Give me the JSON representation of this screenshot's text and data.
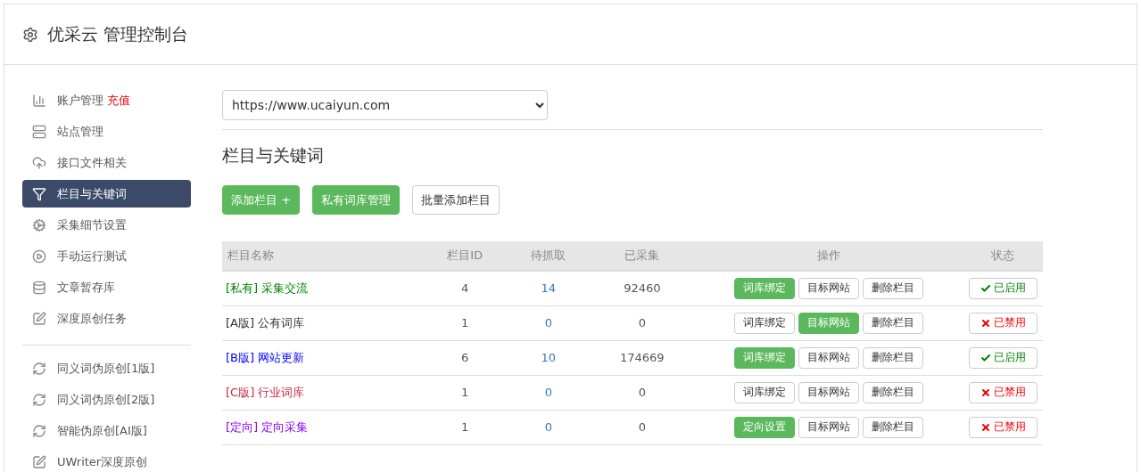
{
  "header": {
    "title": "优采云 管理控制台"
  },
  "sidebar": {
    "items": [
      {
        "label": "账户管理",
        "badge": "充值",
        "selected": false
      },
      {
        "label": "站点管理",
        "selected": false
      },
      {
        "label": "接口文件相关",
        "selected": false
      },
      {
        "label": "栏目与关键词",
        "selected": true
      },
      {
        "label": "采集细节设置",
        "selected": false
      },
      {
        "label": "手动运行测试",
        "selected": false
      },
      {
        "label": "文章暂存库",
        "selected": false
      },
      {
        "label": "深度原创任务",
        "selected": false
      }
    ],
    "items_2": [
      {
        "label": "同义词伪原创[1版]",
        "selected": false
      },
      {
        "label": "同义词伪原创[2版]",
        "selected": false
      },
      {
        "label": "智能伪原创[AI版]",
        "selected": false
      },
      {
        "label": "UWriter深度原创",
        "selected": false
      }
    ]
  },
  "site_select": {
    "value": "https://www.ucaiyun.com"
  },
  "section_title": "栏目与关键词",
  "toolbar": [
    {
      "label": "添加栏目 +",
      "primary": true
    },
    {
      "label": "私有词库管理",
      "primary": true
    },
    {
      "label": "批量添加栏目",
      "primary": false
    }
  ],
  "table": {
    "columns": [
      "栏目名称",
      "栏目ID",
      "待抓取",
      "已采集",
      "操作",
      "状态"
    ],
    "rows": [
      {
        "name": "[私有] 采集交流",
        "color": "#008000",
        "id": "4",
        "pending": "14",
        "collected": "92460",
        "actions": [
          {
            "label": "词库绑定",
            "primary": true
          },
          {
            "label": "目标网站",
            "primary": false
          },
          {
            "label": "删除栏目",
            "primary": false
          }
        ],
        "status": {
          "label": "已启用",
          "enabled": true
        }
      },
      {
        "name": "[A版] 公有词库",
        "color": "#333333",
        "id": "1",
        "pending": "0",
        "collected": "0",
        "actions": [
          {
            "label": "词库绑定",
            "primary": false
          },
          {
            "label": "目标网站",
            "primary": true
          },
          {
            "label": "删除栏目",
            "primary": false
          }
        ],
        "status": {
          "label": "已禁用",
          "enabled": false
        }
      },
      {
        "name": "[B版] 网站更新",
        "color": "#0000ff",
        "id": "6",
        "pending": "10",
        "collected": "174669",
        "actions": [
          {
            "label": "词库绑定",
            "primary": true
          },
          {
            "label": "目标网站",
            "primary": false
          },
          {
            "label": "删除栏目",
            "primary": false
          }
        ],
        "status": {
          "label": "已启用",
          "enabled": true
        }
      },
      {
        "name": "[C版] 行业词库",
        "color": "#cc2244",
        "id": "1",
        "pending": "0",
        "collected": "0",
        "actions": [
          {
            "label": "词库绑定",
            "primary": false
          },
          {
            "label": "目标网站",
            "primary": false
          },
          {
            "label": "删除栏目",
            "primary": false
          }
        ],
        "status": {
          "label": "已禁用",
          "enabled": false
        }
      },
      {
        "name": "[定向] 定向采集",
        "color": "#8800ff",
        "id": "1",
        "pending": "0",
        "collected": "0",
        "actions": [
          {
            "label": "定向设置",
            "primary": true
          },
          {
            "label": "目标网站",
            "primary": false
          },
          {
            "label": "删除栏目",
            "primary": false
          }
        ],
        "status": {
          "label": "已禁用",
          "enabled": false
        }
      }
    ]
  }
}
